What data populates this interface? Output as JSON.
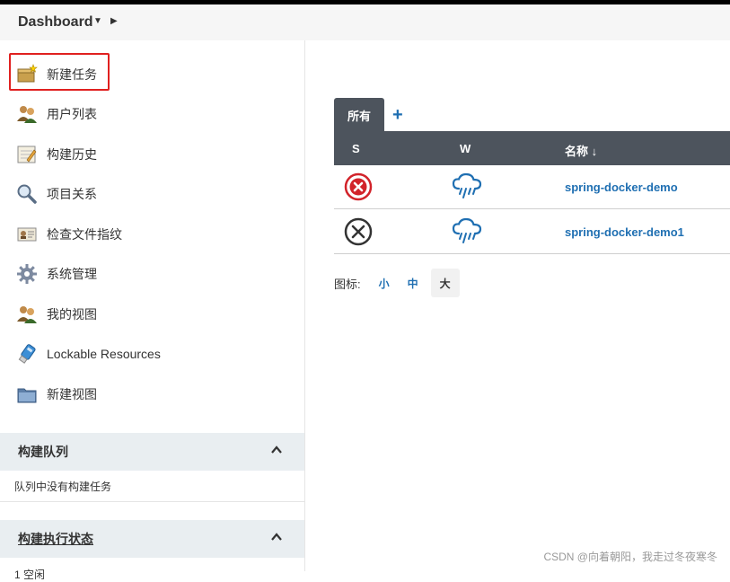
{
  "breadcrumb": {
    "title": "Dashboard"
  },
  "sidebar": {
    "items": [
      {
        "label": "新建任务",
        "icon": "new-job-icon"
      },
      {
        "label": "用户列表",
        "icon": "users-icon"
      },
      {
        "label": "构建历史",
        "icon": "build-history-icon"
      },
      {
        "label": "项目关系",
        "icon": "search-icon"
      },
      {
        "label": "检查文件指纹",
        "icon": "fingerprint-icon"
      },
      {
        "label": "系统管理",
        "icon": "gear-icon"
      },
      {
        "label": "我的视图",
        "icon": "user-views-icon"
      },
      {
        "label": "Lockable Resources",
        "icon": "usb-icon"
      },
      {
        "label": "新建视图",
        "icon": "folder-icon"
      }
    ],
    "build_queue": {
      "title": "构建队列",
      "empty_text": "队列中没有构建任务"
    },
    "executor_status": {
      "title": "构建执行状态",
      "partial_text": "1 空闲"
    }
  },
  "main": {
    "tabs": [
      {
        "label": "所有"
      }
    ],
    "add_tab_label": "+",
    "table": {
      "columns": {
        "s": "S",
        "w": "W",
        "name": "名称 ↓"
      },
      "rows": [
        {
          "status": "failed",
          "weather": "rain",
          "name": "spring-docker-demo"
        },
        {
          "status": "not-built",
          "weather": "rain",
          "name": "spring-docker-demo1"
        }
      ]
    },
    "icon_size": {
      "label": "图标:",
      "options": [
        "小",
        "中",
        "大"
      ],
      "selected": "大"
    }
  },
  "watermark": "CSDN @向着朝阳，我走过冬夜寒冬",
  "colors": {
    "accent": "#1f6fb2",
    "header_bg": "#4d545d",
    "failed": "#d2232a",
    "highlight_border": "#e0201f"
  }
}
